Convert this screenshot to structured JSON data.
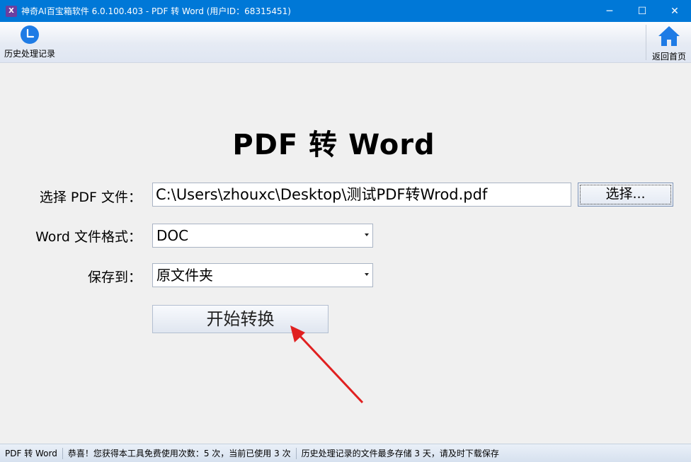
{
  "window": {
    "title": "神奇AI百宝箱软件 6.0.100.403 - PDF 转 Word (用户ID：68315451)",
    "logo_text": "X",
    "minimize_glyph": "─",
    "maximize_glyph": "☐",
    "close_glyph": "✕"
  },
  "toolbar": {
    "history_label": "历史处理记录",
    "history_icon": "clock-icon",
    "home_label": "返回首页",
    "home_icon": "home-icon",
    "accent_color": "#1e7be5"
  },
  "main": {
    "title": "PDF 转 Word",
    "file_label": "选择 PDF 文件：",
    "file_value": "C:\\Users\\zhouxc\\Desktop\\测试PDF转Wrod.pdf",
    "choose_button": "选择...",
    "format_label": "Word 文件格式：",
    "format_value": "DOC",
    "save_label": "保存到：",
    "save_value": "原文件夹",
    "start_button": "开始转换",
    "annotation_color": "#e02020"
  },
  "statusbar": {
    "tool_name": "PDF 转 Word",
    "usage_text": "恭喜！您获得本工具免费使用次数：5 次，当前已使用 3 次",
    "storage_text": "历史处理记录的文件最多存储 3 天，请及时下载保存"
  }
}
